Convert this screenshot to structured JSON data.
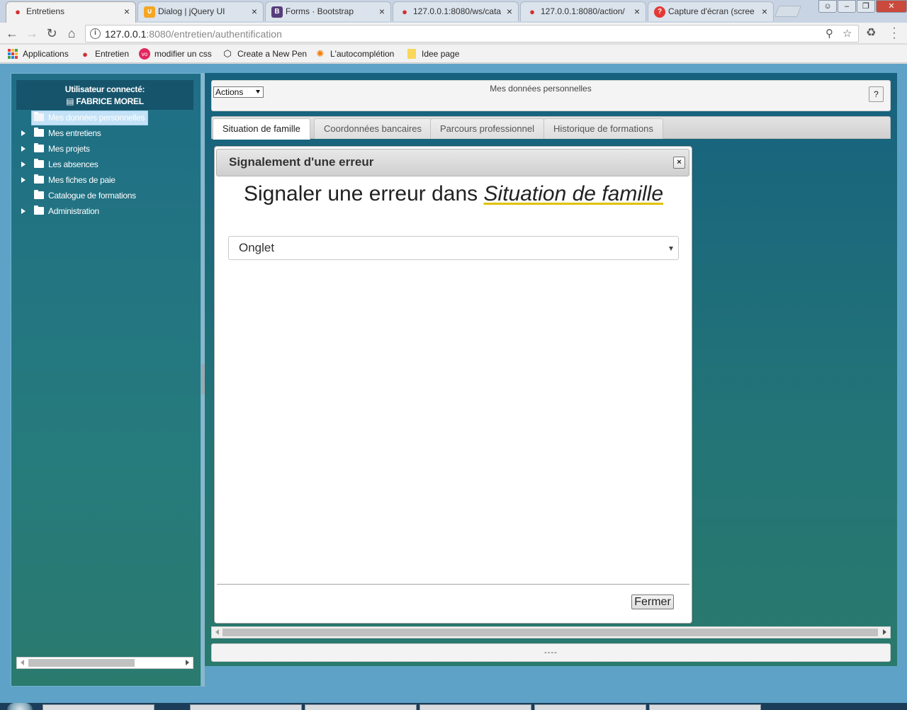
{
  "browser": {
    "tabs": [
      {
        "title": "Entretiens",
        "icon": "speech-bubble-icon",
        "active": true
      },
      {
        "title": "Dialog | jQuery UI",
        "icon": "jquery-icon",
        "active": false
      },
      {
        "title": "Forms · Bootstrap",
        "icon": "bootstrap-icon",
        "active": false
      },
      {
        "title": "127.0.0.1:8080/ws/cata",
        "icon": "speech-bubble-icon",
        "active": false
      },
      {
        "title": "127.0.0.1:8080/action/",
        "icon": "speech-bubble-icon",
        "active": false
      },
      {
        "title": "Capture d'écran (scree",
        "icon": "capture-icon",
        "active": false
      }
    ],
    "bs_glyph": "B",
    "url_host": "127.0.0.1",
    "url_rest": ":8080/entretien/authentification",
    "bookmarks": [
      {
        "label": "Applications",
        "icon": "apps-grid-icon"
      },
      {
        "label": "Entretien",
        "icon": "speech-bubble-icon"
      },
      {
        "label": "modifier un css",
        "icon": "vo-icon"
      },
      {
        "label": "Create a New Pen",
        "icon": "codepen-icon"
      },
      {
        "label": "L'autocomplétion",
        "icon": "swirl-icon"
      },
      {
        "label": "Idee page",
        "icon": "folder-icon"
      }
    ],
    "vo_glyph": "vo"
  },
  "sidebar": {
    "user_label": "Utilisateur connecté:",
    "user_name": "FABRICE MOREL",
    "items": [
      {
        "label": "Mes données personnelles",
        "selected": true,
        "expandable": false
      },
      {
        "label": "Mes entretiens",
        "selected": false,
        "expandable": true
      },
      {
        "label": "Mes projets",
        "selected": false,
        "expandable": true
      },
      {
        "label": "Les absences",
        "selected": false,
        "expandable": true
      },
      {
        "label": "Mes fiches de paie",
        "selected": false,
        "expandable": true
      },
      {
        "label": "Catalogue de formations",
        "selected": false,
        "expandable": false
      },
      {
        "label": "Administration",
        "selected": false,
        "expandable": true
      }
    ]
  },
  "header": {
    "actions_label": "Actions",
    "title": "Mes données personnelles",
    "help_label": "?"
  },
  "tabs": [
    {
      "label": "Situation de famille",
      "active": true
    },
    {
      "label": "Coordonnées bancaires",
      "active": false
    },
    {
      "label": "Parcours professionnel",
      "active": false
    },
    {
      "label": "Historique de formations",
      "active": false
    }
  ],
  "dialog": {
    "title": "Signalement d'une erreur",
    "close_label": "×",
    "heading_prefix": "Signaler une erreur dans",
    "heading_target": "Situation de famille",
    "select_value": "Onglet",
    "close_button_label": "Fermer"
  },
  "footer": {
    "text": "----"
  },
  "colors": {
    "accent": "#1f6e86",
    "page_bg": "#5ea2c8",
    "heading_underline": "#e0c100"
  }
}
